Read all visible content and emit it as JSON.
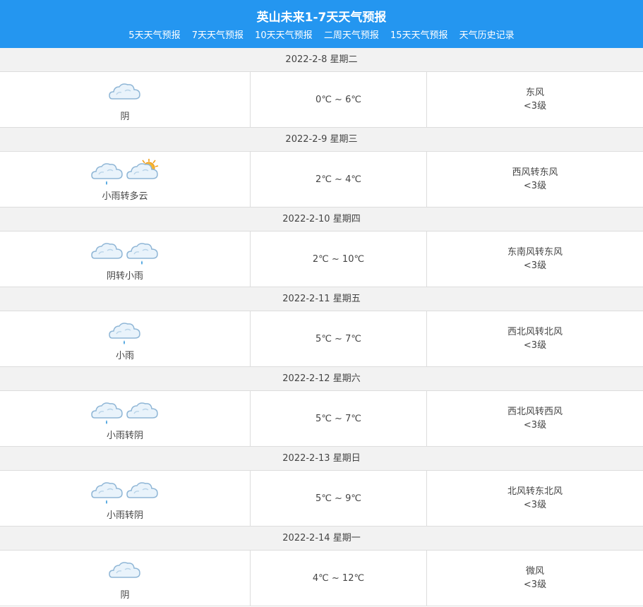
{
  "header": {
    "title": "英山未来1-7天天气预报",
    "nav": [
      "5天天气预报",
      "7天天气预报",
      "10天天气预报",
      "二周天气预报",
      "15天天气预报",
      "天气历史记录"
    ]
  },
  "days": [
    {
      "date": "2022-2-8 星期二",
      "icons": [
        "overcast"
      ],
      "desc": "阴",
      "temp": "0℃ ~ 6℃",
      "wind": "东风",
      "level": "<3级"
    },
    {
      "date": "2022-2-9 星期三",
      "icons": [
        "light-rain",
        "partly-cloudy"
      ],
      "desc": "小雨转多云",
      "temp": "2℃ ~ 4℃",
      "wind": "西风转东风",
      "level": "<3级"
    },
    {
      "date": "2022-2-10 星期四",
      "icons": [
        "overcast",
        "light-rain"
      ],
      "desc": "阴转小雨",
      "temp": "2℃ ~ 10℃",
      "wind": "东南风转东风",
      "level": "<3级"
    },
    {
      "date": "2022-2-11 星期五",
      "icons": [
        "light-rain"
      ],
      "desc": "小雨",
      "temp": "5℃ ~ 7℃",
      "wind": "西北风转北风",
      "level": "<3级"
    },
    {
      "date": "2022-2-12 星期六",
      "icons": [
        "light-rain",
        "overcast"
      ],
      "desc": "小雨转阴",
      "temp": "5℃ ~ 7℃",
      "wind": "西北风转西风",
      "level": "<3级"
    },
    {
      "date": "2022-2-13 星期日",
      "icons": [
        "light-rain",
        "overcast"
      ],
      "desc": "小雨转阴",
      "temp": "5℃ ~ 9℃",
      "wind": "北风转东北风",
      "level": "<3级"
    },
    {
      "date": "2022-2-14 星期一",
      "icons": [
        "overcast"
      ],
      "desc": "阴",
      "temp": "4℃ ~ 12℃",
      "wind": "微风",
      "level": "<3级"
    }
  ],
  "colors": {
    "header_bg": "#2496f0",
    "day_head_bg": "#f2f2f2"
  }
}
